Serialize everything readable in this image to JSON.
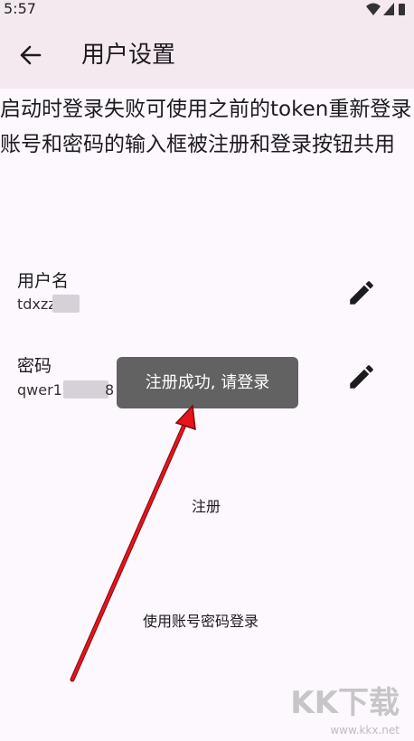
{
  "status_bar": {
    "time": "5:57"
  },
  "app_bar": {
    "title": "用户设置",
    "back_icon": "arrow-back-icon"
  },
  "description": "启动时登录失败可使用之前的token重新登录 账号和密码的输入框被注册和登录按钮共用",
  "fields": [
    {
      "label": "用户名",
      "value": "tdxzz",
      "edit_icon": "pencil-icon"
    },
    {
      "label": "密码",
      "value": "qwer1",
      "value_suffix": "8",
      "edit_icon": "pencil-icon"
    }
  ],
  "toast": {
    "text": "注册成功, 请登录"
  },
  "buttons": {
    "register": "注册",
    "login_with_account": "使用账号密码登录"
  },
  "annotation": {
    "arrow_color": "#e8141c"
  },
  "watermark": {
    "logo": "KK下载",
    "url": "www.kkx.net"
  }
}
